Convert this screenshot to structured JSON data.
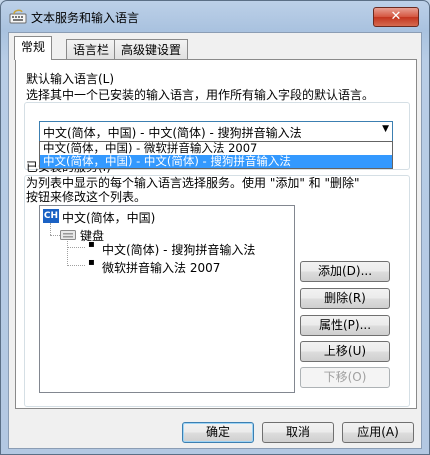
{
  "window": {
    "title": "文本服务和输入语言",
    "close_glyph": "✕"
  },
  "tabs": [
    {
      "label": "常规"
    },
    {
      "label": "语言栏"
    },
    {
      "label": "高级键设置"
    }
  ],
  "default_language": {
    "heading": "默认输入语言(L)",
    "description": "选择其中一个已安装的输入语言，用作所有输入字段的默认语言。",
    "selected_value": "中文(简体，中国) - 中文(简体) - 搜狗拼音输入法",
    "dropdown_options": [
      {
        "label": "中文(简体，中国) - 微软拼音输入法 2007"
      },
      {
        "label": "中文(简体，中国) - 中文(简体) - 搜狗拼音输入法"
      }
    ]
  },
  "installed_services": {
    "heading_partial": "已安装的服务(I)",
    "description_line1": "为列表中显示的每个输入语言选择服务。使用 \"添加\" 和 \"删除\"",
    "description_line2": "按钮来修改这个列表。",
    "tree": {
      "language_code": "CH",
      "language_label": "中文(简体，中国)",
      "category_label": "键盘",
      "services": [
        {
          "label": "中文(简体) - 搜狗拼音输入法"
        },
        {
          "label": "微软拼音输入法 2007"
        }
      ]
    },
    "buttons": {
      "add": "添加(D)...",
      "remove": "删除(R)",
      "properties": "属性(P)...",
      "move_up": "上移(U)",
      "move_down": "下移(O)"
    }
  },
  "footer": {
    "ok": "确定",
    "cancel": "取消",
    "apply": "应用(A)"
  }
}
